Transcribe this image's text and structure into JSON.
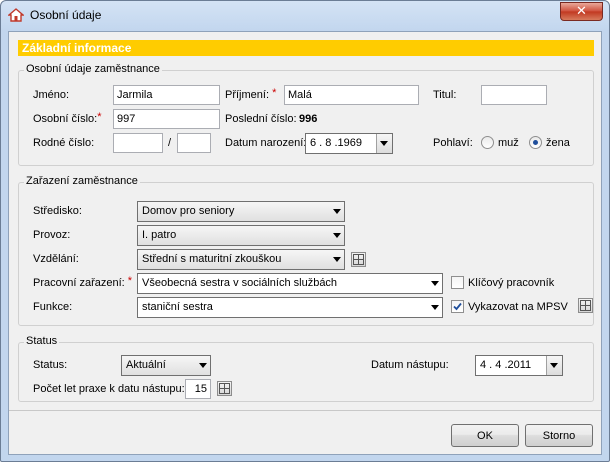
{
  "window": {
    "title": "Osobní údaje",
    "close_glyph": "✕"
  },
  "banner": {
    "text": "Základní informace",
    "color": "#ffcc00"
  },
  "personal": {
    "legend": "Osobní údaje zaměstnance",
    "jmeno_label": "Jméno:",
    "jmeno_value": "Jarmila",
    "prijmeni_label": "Příjmení:",
    "prijmeni_value": "Malá",
    "titul_label": "Titul:",
    "titul_value": "",
    "osobni_cislo_label": "Osobní číslo:",
    "osobni_cislo_value": "997",
    "posledni_cislo_label": "Poslední číslo:",
    "posledni_cislo_value": "996",
    "rodne_cislo_label": "Rodné číslo:",
    "rodne_cislo_part1": "",
    "rodne_cislo_sep": "/",
    "rodne_cislo_part2": "",
    "datum_narozeni_label": "Datum narození:",
    "datum_narozeni_value": "6 . 8 .1969",
    "pohlavi_label": "Pohlaví:",
    "muz_label": "muž",
    "zena_label": "žena",
    "selected_gender": "žena"
  },
  "assignment": {
    "legend": "Zařazení zaměstnance",
    "stredisko_label": "Středisko:",
    "stredisko_value": "Domov pro seniory",
    "provoz_label": "Provoz:",
    "provoz_value": "I. patro",
    "vzdelani_label": "Vzdělání:",
    "vzdelani_value": "Střední s maturitní zkouškou",
    "pracovni_zarazeni_label": "Pracovní zařazení:",
    "pracovni_zarazeni_value": "Všeobecná sestra v sociálních službách",
    "klicovy_label": "Klíčový pracovník",
    "klicovy_checked": false,
    "funkce_label": "Funkce:",
    "funkce_value": "staniční sestra",
    "vykazovat_label": "Vykazovat na MPSV",
    "vykazovat_checked": true
  },
  "status": {
    "legend": "Status",
    "status_label": "Status:",
    "status_value": "Aktuální",
    "datum_nastupu_label": "Datum nástupu:",
    "datum_nastupu_value": "4 . 4 .2011",
    "praxe_label": "Počet let praxe k datu nástupu:",
    "praxe_value": "15"
  },
  "buttons": {
    "ok_label": "OK",
    "cancel_label": "Storno"
  },
  "icons": {
    "required_mark": "*",
    "check_mark": "✓"
  }
}
